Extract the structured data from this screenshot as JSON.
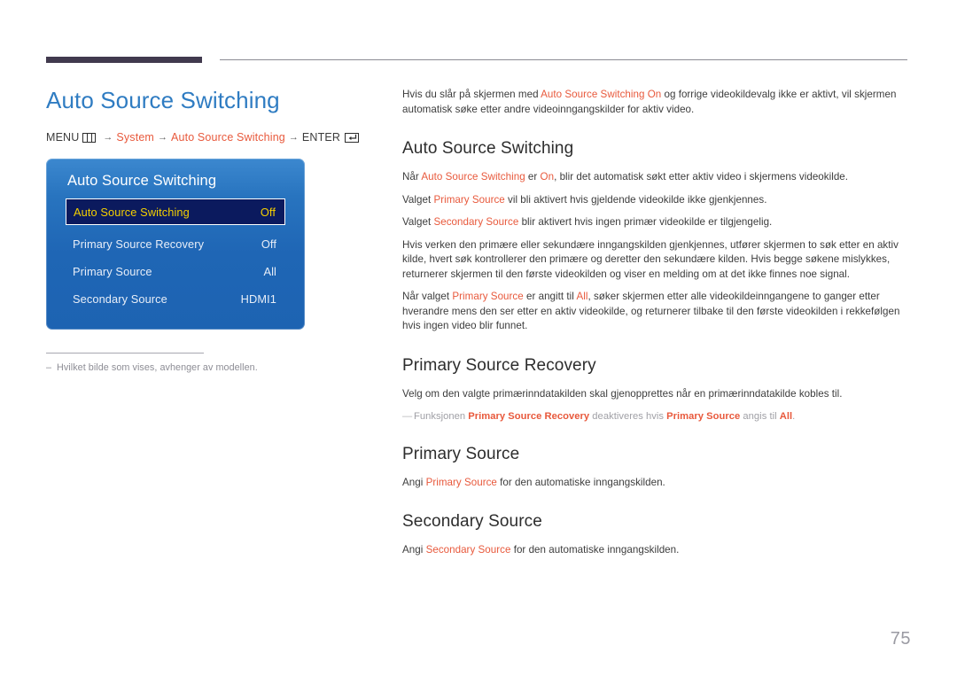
{
  "page": {
    "number": "75"
  },
  "left": {
    "title": "Auto Source Switching",
    "breadcrumb": {
      "menu_label": "MENU",
      "menu_icon": "menu-grid-icon",
      "arrow": "→",
      "step1": "System",
      "step2": "Auto Source Switching",
      "enter_label": "ENTER",
      "enter_icon": "enter-return-icon"
    },
    "osd": {
      "title": "Auto Source Switching",
      "rows": [
        {
          "label": "Auto Source Switching",
          "value": "Off",
          "selected": true
        },
        {
          "label": "Primary Source Recovery",
          "value": "Off",
          "selected": false
        },
        {
          "label": "Primary Source",
          "value": "All",
          "selected": false
        },
        {
          "label": "Secondary Source",
          "value": "HDMI1",
          "selected": false
        }
      ]
    },
    "note": {
      "dash": "‒",
      "text": "Hvilket bilde som vises, avhenger av modellen."
    }
  },
  "right": {
    "intro": {
      "part1": "Hvis du slår på skjermen med ",
      "hl1": "Auto Source Switching On",
      "part2": " og forrige videokildevalg ikke er aktivt, vil skjermen automatisk søke etter andre videoinngangskilder for aktiv video."
    },
    "sections": [
      {
        "heading": "Auto Source Switching",
        "paragraphs": [
          {
            "p1": "Når ",
            "hl1": "Auto Source Switching",
            "p2": " er ",
            "hl2": "On",
            "p3": ", blir det automatisk søkt etter aktiv video i skjermens videokilde."
          },
          {
            "p1": "Valget ",
            "hl1": "Primary Source",
            "p2": " vil bli aktivert hvis gjeldende videokilde ikke gjenkjennes.",
            "hl2": "",
            "p3": ""
          },
          {
            "p1": "Valget ",
            "hl1": "Secondary Source",
            "p2": " blir aktivert hvis ingen primær videokilde er tilgjengelig.",
            "hl2": "",
            "p3": ""
          },
          {
            "p1": "Hvis verken den primære eller sekundære inngangskilden gjenkjennes, utfører skjermen to søk etter en aktiv kilde, hvert søk kontrollerer den primære og deretter den sekundære kilden. Hvis begge søkene mislykkes, returnerer skjermen til den første videokilden og viser en melding om at det ikke finnes noe signal.",
            "hl1": "",
            "p2": "",
            "hl2": "",
            "p3": ""
          },
          {
            "p1": "Når valget ",
            "hl1": "Primary Source",
            "p2": " er angitt til ",
            "hl2": "All",
            "p3": ", søker skjermen etter alle videokildeinngangene to ganger etter hverandre mens den ser etter en aktiv videokilde, og returnerer tilbake til den første videokilden i rekkefølgen hvis ingen video blir funnet."
          }
        ]
      },
      {
        "heading": "Primary Source Recovery",
        "lead": "Velg om den valgte primærinndatakilden skal gjenopprettes når en primærinndatakilde kobles til.",
        "note": {
          "dash": "―",
          "n1": "Funksjonen ",
          "hl1": "Primary Source Recovery",
          "n2": " deaktiveres hvis ",
          "hl2": "Primary Source",
          "n3": " angis til ",
          "hl3": "All",
          "n4": "."
        }
      },
      {
        "heading": "Primary Source",
        "para": {
          "p1": "Angi ",
          "hl1": "Primary Source",
          "p2": " for den automatiske inngangskilden."
        }
      },
      {
        "heading": "Secondary Source",
        "para": {
          "p1": "Angi ",
          "hl1": "Secondary Source",
          "p2": " for den automatiske inngangskilden."
        }
      }
    ]
  },
  "colors": {
    "title_blue": "#2f7cc2",
    "highlight_orange": "#e8593c",
    "osd_blue": "#1f66b5",
    "osd_selected_bg": "#0b1a5e",
    "osd_selected_text": "#f5d000",
    "rule_dark": "#413a4e"
  }
}
